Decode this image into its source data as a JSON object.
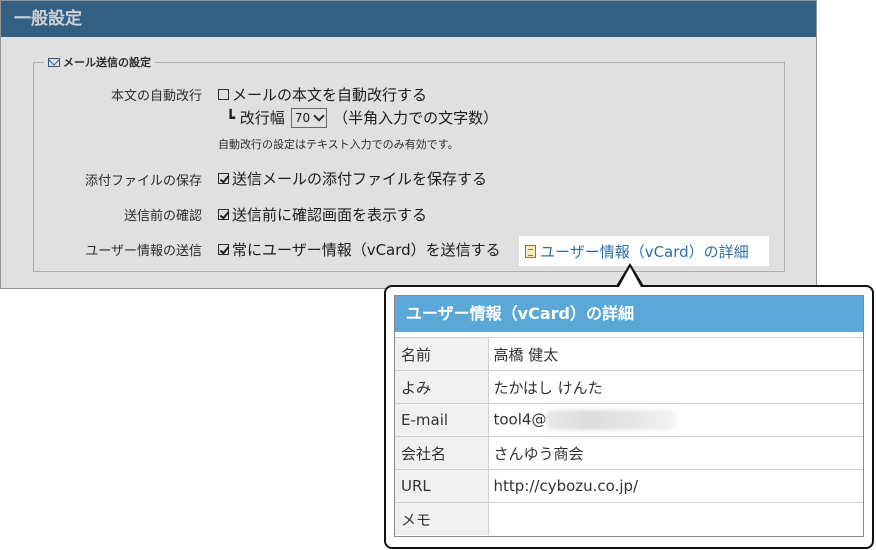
{
  "panel": {
    "title": "一般設定",
    "section_legend": "メール送信の設定",
    "rows": {
      "autowrap": {
        "label": "本文の自動改行",
        "checkbox_text": "メールの本文を自動改行する",
        "checked": false,
        "width_prefix": "┗ 改行幅",
        "width_value": "70",
        "width_suffix": "（半角入力での文字数）",
        "note": "自動改行の設定はテキスト入力でのみ有効です。"
      },
      "attachments": {
        "label": "添付ファイルの保存",
        "checkbox_text": "送信メールの添付ファイルを保存する",
        "checked": true
      },
      "confirm": {
        "label": "送信前の確認",
        "checkbox_text": "送信前に確認画面を表示する",
        "checked": true
      },
      "vcard": {
        "label": "ユーザー情報の送信",
        "checkbox_text": "常にユーザー情報（vCard）を送信する",
        "checked": true,
        "link_text": "ユーザー情報（vCard）の詳細"
      }
    }
  },
  "detail": {
    "title": "ユーザー情報（vCard）の詳細",
    "rows": [
      {
        "key": "名前",
        "value": "高橋 健太"
      },
      {
        "key": "よみ",
        "value": "たかはし けんた"
      },
      {
        "key": "E-mail",
        "value": "tool4@"
      },
      {
        "key": "会社名",
        "value": "さんゆう商会"
      },
      {
        "key": "URL",
        "value": "http://cybozu.co.jp/"
      },
      {
        "key": "メモ",
        "value": ""
      }
    ]
  },
  "colors": {
    "header_bg": "#3b6e94",
    "detail_header_bg": "#5ba7d7",
    "link": "#2d6fa8"
  }
}
